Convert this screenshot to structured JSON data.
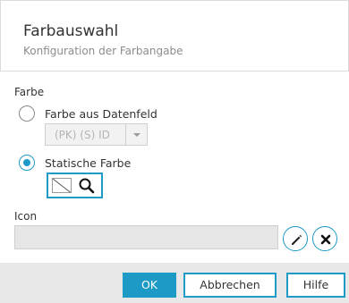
{
  "dialog": {
    "title": "Farbauswahl",
    "subtitle": "Konfiguration der Farbangabe"
  },
  "color_section": {
    "label": "Farbe",
    "option_datafield": {
      "label": "Farbe aus Datenfeld",
      "checked": false
    },
    "datafield_select": {
      "value": "(PK) (S) ID",
      "disabled": true
    },
    "option_static": {
      "label": "Statische Farbe",
      "checked": true
    },
    "static_color": {
      "value": "none",
      "search_icon": "magnifier-icon"
    }
  },
  "icon_section": {
    "label": "Icon",
    "value": "",
    "edit_icon": "pencil-icon",
    "clear_icon": "close-icon"
  },
  "footer": {
    "ok_label": "OK",
    "cancel_label": "Abbrechen",
    "help_label": "Hilfe"
  },
  "colors": {
    "accent": "#1e9ac7",
    "background": "#e8e8e8"
  }
}
